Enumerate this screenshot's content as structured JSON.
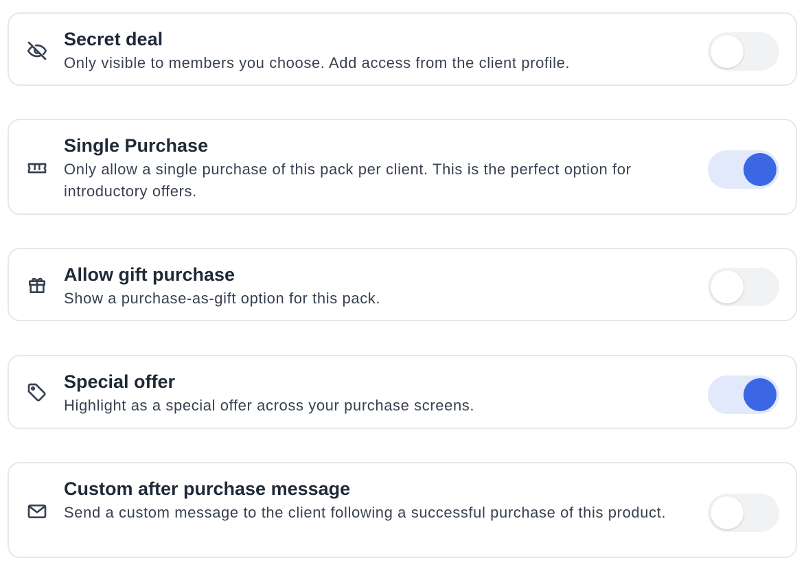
{
  "options": [
    {
      "icon": "eye-off-icon",
      "title": "Secret deal",
      "description": "Only visible to members you choose. Add access from the client profile.",
      "enabled": false
    },
    {
      "icon": "ticket-icon",
      "title": "Single Purchase",
      "description": "Only allow a single purchase of this pack per client. This is the perfect option for introductory offers.",
      "enabled": true
    },
    {
      "icon": "gift-icon",
      "title": "Allow gift purchase",
      "description": "Show a purchase-as-gift option for this pack.",
      "enabled": false
    },
    {
      "icon": "tag-icon",
      "title": "Special offer",
      "description": "Highlight as a special offer across your purchase screens.",
      "enabled": true
    },
    {
      "icon": "mail-icon",
      "title": "Custom after purchase message",
      "description": "Send a custom message to the client following a successful purchase of this product.",
      "enabled": false
    }
  ],
  "colors": {
    "toggle_on_track": "#e1e9fb",
    "toggle_on_knob": "#3b66e4",
    "toggle_off_track": "#f1f2f4",
    "card_border": "#e5e7eb",
    "text": "#1f2937"
  }
}
